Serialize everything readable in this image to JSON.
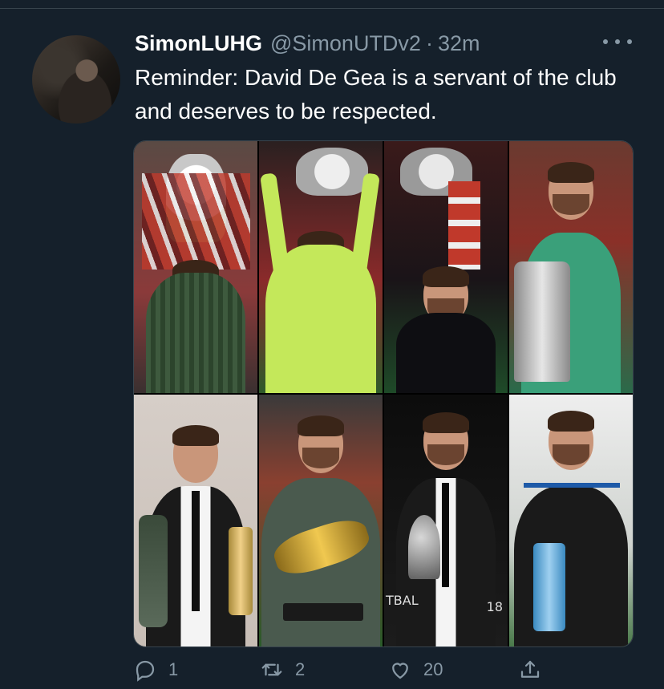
{
  "tweet": {
    "display_name": "SimonLUHG",
    "handle": "@SimonUTDv2",
    "separator": "·",
    "time": "32m",
    "text": "Reminder: David De Gea is a servant of the club and deserves to be respected."
  },
  "media": {
    "photos": [
      {
        "name": "photo-premier-league-trophy"
      },
      {
        "name": "photo-fa-cup-celebration"
      },
      {
        "name": "photo-league-cup-trophy"
      },
      {
        "name": "photo-europa-league-trophy"
      },
      {
        "name": "photo-suit-awards"
      },
      {
        "name": "photo-golden-glove-award"
      },
      {
        "name": "photo-the-best-award",
        "caption_left": "TBAL",
        "caption_right": "18"
      },
      {
        "name": "photo-player-of-month-award"
      }
    ]
  },
  "actions": {
    "reply_count": "1",
    "retweet_count": "2",
    "like_count": "20",
    "icons": [
      "reply-icon",
      "retweet-icon",
      "like-icon",
      "share-icon"
    ],
    "color": "#8899a6"
  },
  "colors": {
    "background": "#15202b",
    "text": "#ffffff",
    "secondary": "#8899a6"
  }
}
